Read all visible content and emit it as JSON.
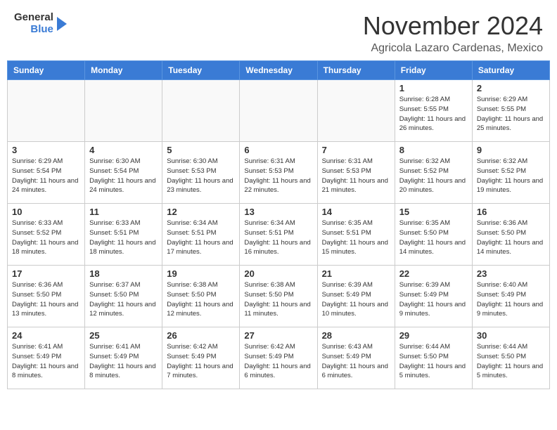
{
  "header": {
    "logo_general": "General",
    "logo_blue": "Blue",
    "month_title": "November 2024",
    "location": "Agricola Lazaro Cardenas, Mexico"
  },
  "weekdays": [
    "Sunday",
    "Monday",
    "Tuesday",
    "Wednesday",
    "Thursday",
    "Friday",
    "Saturday"
  ],
  "weeks": [
    [
      {
        "day": "",
        "info": ""
      },
      {
        "day": "",
        "info": ""
      },
      {
        "day": "",
        "info": ""
      },
      {
        "day": "",
        "info": ""
      },
      {
        "day": "",
        "info": ""
      },
      {
        "day": "1",
        "info": "Sunrise: 6:28 AM\nSunset: 5:55 PM\nDaylight: 11 hours and 26 minutes."
      },
      {
        "day": "2",
        "info": "Sunrise: 6:29 AM\nSunset: 5:55 PM\nDaylight: 11 hours and 25 minutes."
      }
    ],
    [
      {
        "day": "3",
        "info": "Sunrise: 6:29 AM\nSunset: 5:54 PM\nDaylight: 11 hours and 24 minutes."
      },
      {
        "day": "4",
        "info": "Sunrise: 6:30 AM\nSunset: 5:54 PM\nDaylight: 11 hours and 24 minutes."
      },
      {
        "day": "5",
        "info": "Sunrise: 6:30 AM\nSunset: 5:53 PM\nDaylight: 11 hours and 23 minutes."
      },
      {
        "day": "6",
        "info": "Sunrise: 6:31 AM\nSunset: 5:53 PM\nDaylight: 11 hours and 22 minutes."
      },
      {
        "day": "7",
        "info": "Sunrise: 6:31 AM\nSunset: 5:53 PM\nDaylight: 11 hours and 21 minutes."
      },
      {
        "day": "8",
        "info": "Sunrise: 6:32 AM\nSunset: 5:52 PM\nDaylight: 11 hours and 20 minutes."
      },
      {
        "day": "9",
        "info": "Sunrise: 6:32 AM\nSunset: 5:52 PM\nDaylight: 11 hours and 19 minutes."
      }
    ],
    [
      {
        "day": "10",
        "info": "Sunrise: 6:33 AM\nSunset: 5:52 PM\nDaylight: 11 hours and 18 minutes."
      },
      {
        "day": "11",
        "info": "Sunrise: 6:33 AM\nSunset: 5:51 PM\nDaylight: 11 hours and 18 minutes."
      },
      {
        "day": "12",
        "info": "Sunrise: 6:34 AM\nSunset: 5:51 PM\nDaylight: 11 hours and 17 minutes."
      },
      {
        "day": "13",
        "info": "Sunrise: 6:34 AM\nSunset: 5:51 PM\nDaylight: 11 hours and 16 minutes."
      },
      {
        "day": "14",
        "info": "Sunrise: 6:35 AM\nSunset: 5:51 PM\nDaylight: 11 hours and 15 minutes."
      },
      {
        "day": "15",
        "info": "Sunrise: 6:35 AM\nSunset: 5:50 PM\nDaylight: 11 hours and 14 minutes."
      },
      {
        "day": "16",
        "info": "Sunrise: 6:36 AM\nSunset: 5:50 PM\nDaylight: 11 hours and 14 minutes."
      }
    ],
    [
      {
        "day": "17",
        "info": "Sunrise: 6:36 AM\nSunset: 5:50 PM\nDaylight: 11 hours and 13 minutes."
      },
      {
        "day": "18",
        "info": "Sunrise: 6:37 AM\nSunset: 5:50 PM\nDaylight: 11 hours and 12 minutes."
      },
      {
        "day": "19",
        "info": "Sunrise: 6:38 AM\nSunset: 5:50 PM\nDaylight: 11 hours and 12 minutes."
      },
      {
        "day": "20",
        "info": "Sunrise: 6:38 AM\nSunset: 5:50 PM\nDaylight: 11 hours and 11 minutes."
      },
      {
        "day": "21",
        "info": "Sunrise: 6:39 AM\nSunset: 5:49 PM\nDaylight: 11 hours and 10 minutes."
      },
      {
        "day": "22",
        "info": "Sunrise: 6:39 AM\nSunset: 5:49 PM\nDaylight: 11 hours and 9 minutes."
      },
      {
        "day": "23",
        "info": "Sunrise: 6:40 AM\nSunset: 5:49 PM\nDaylight: 11 hours and 9 minutes."
      }
    ],
    [
      {
        "day": "24",
        "info": "Sunrise: 6:41 AM\nSunset: 5:49 PM\nDaylight: 11 hours and 8 minutes."
      },
      {
        "day": "25",
        "info": "Sunrise: 6:41 AM\nSunset: 5:49 PM\nDaylight: 11 hours and 8 minutes."
      },
      {
        "day": "26",
        "info": "Sunrise: 6:42 AM\nSunset: 5:49 PM\nDaylight: 11 hours and 7 minutes."
      },
      {
        "day": "27",
        "info": "Sunrise: 6:42 AM\nSunset: 5:49 PM\nDaylight: 11 hours and 6 minutes."
      },
      {
        "day": "28",
        "info": "Sunrise: 6:43 AM\nSunset: 5:49 PM\nDaylight: 11 hours and 6 minutes."
      },
      {
        "day": "29",
        "info": "Sunrise: 6:44 AM\nSunset: 5:50 PM\nDaylight: 11 hours and 5 minutes."
      },
      {
        "day": "30",
        "info": "Sunrise: 6:44 AM\nSunset: 5:50 PM\nDaylight: 11 hours and 5 minutes."
      }
    ]
  ]
}
